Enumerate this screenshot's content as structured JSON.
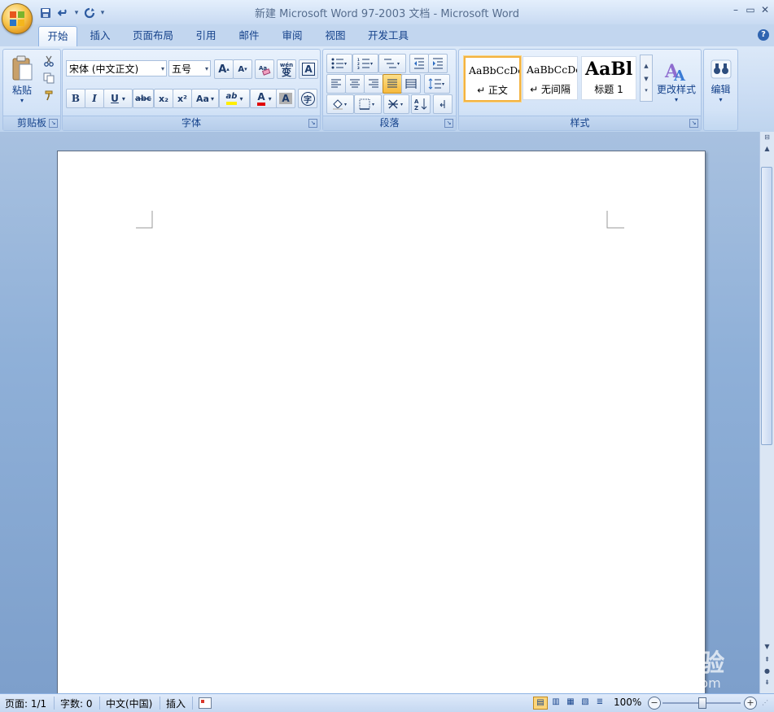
{
  "window": {
    "title": "新建 Microsoft Word 97-2003 文档 - Microsoft Word"
  },
  "tabs": [
    {
      "label": "开始",
      "active": true
    },
    {
      "label": "插入"
    },
    {
      "label": "页面布局"
    },
    {
      "label": "引用"
    },
    {
      "label": "邮件"
    },
    {
      "label": "审阅"
    },
    {
      "label": "视图"
    },
    {
      "label": "开发工具"
    }
  ],
  "ribbon": {
    "clipboard": {
      "group_label": "剪贴板",
      "paste_label": "粘贴"
    },
    "font": {
      "group_label": "字体",
      "font_name": "宋体 (中文正文)",
      "font_size": "五号",
      "grow": "A",
      "shrink": "A",
      "bold": "B",
      "italic": "I",
      "underline": "U",
      "strike": "abc",
      "sub": "x₂",
      "sup": "x²",
      "case": "Aa",
      "phonetic": "wén",
      "phonetic_char": "变",
      "border_char": "A",
      "shade_char": "A",
      "enclose_char": "字",
      "color_char": "A",
      "highlight": "ab"
    },
    "paragraph": {
      "group_label": "段落"
    },
    "styles": {
      "group_label": "样式",
      "items": [
        {
          "sample": "AaBbCcDc",
          "name": "↵ 正文",
          "selected": true
        },
        {
          "sample": "AaBbCcDc",
          "name": "↵ 无间隔"
        },
        {
          "sample": "AaBl",
          "name": "标题 1"
        }
      ],
      "change_styles_label": "更改样式"
    },
    "editing": {
      "label": "编辑"
    }
  },
  "statusbar": {
    "page": "页面: 1/1",
    "words": "字数: 0",
    "language": "中文(中国)",
    "mode": "插入",
    "zoom": "100%"
  },
  "watermark": {
    "line1": "Baidu经验",
    "line2": "jingyan.baidu.com"
  }
}
